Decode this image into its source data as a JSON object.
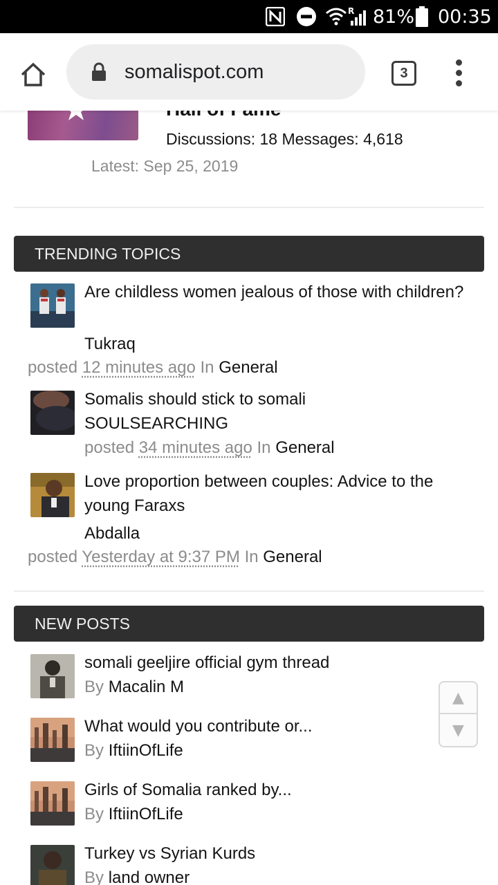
{
  "status_bar": {
    "battery": "81%",
    "time": "00:35",
    "roaming": "R"
  },
  "browser": {
    "url": "somalispot.com",
    "tab_count": "3"
  },
  "forum_node": {
    "title": "Hall of Fame",
    "stats": "Discussions: 18 Messages: 4,618",
    "latest": "Latest: Sep 25, 2019"
  },
  "trending": {
    "header": "TRENDING TOPICS",
    "items": [
      {
        "title": "Are childless women jealous of those with children?",
        "user": "Tukraq",
        "posted": "posted",
        "time": "12 minutes ago",
        "in": "In",
        "forum": "General"
      },
      {
        "title": "Somalis should stick to somali",
        "user": "SOULSEARCHING",
        "posted": "posted",
        "time": "34 minutes ago",
        "in": "In",
        "forum": "General"
      },
      {
        "title": "Love proportion between couples: Advice to the young Faraxs",
        "user": "Abdalla",
        "posted": "posted",
        "time": "Yesterday at 9:37 PM",
        "in": "In",
        "forum": "General"
      }
    ]
  },
  "new_posts": {
    "header": "NEW POSTS",
    "by_label": "By",
    "items": [
      {
        "title": "somali geeljire official gym thread",
        "user": "Macalin M"
      },
      {
        "title": "What would you contribute or...",
        "user": "IftiinOfLife"
      },
      {
        "title": "Girls of Somalia ranked by...",
        "user": "IftiinOfLife"
      },
      {
        "title": "Turkey vs Syrian Kurds",
        "user": "land owner"
      }
    ]
  },
  "scroll_widget": {
    "up_icon": "▲",
    "down_icon": "▼"
  }
}
